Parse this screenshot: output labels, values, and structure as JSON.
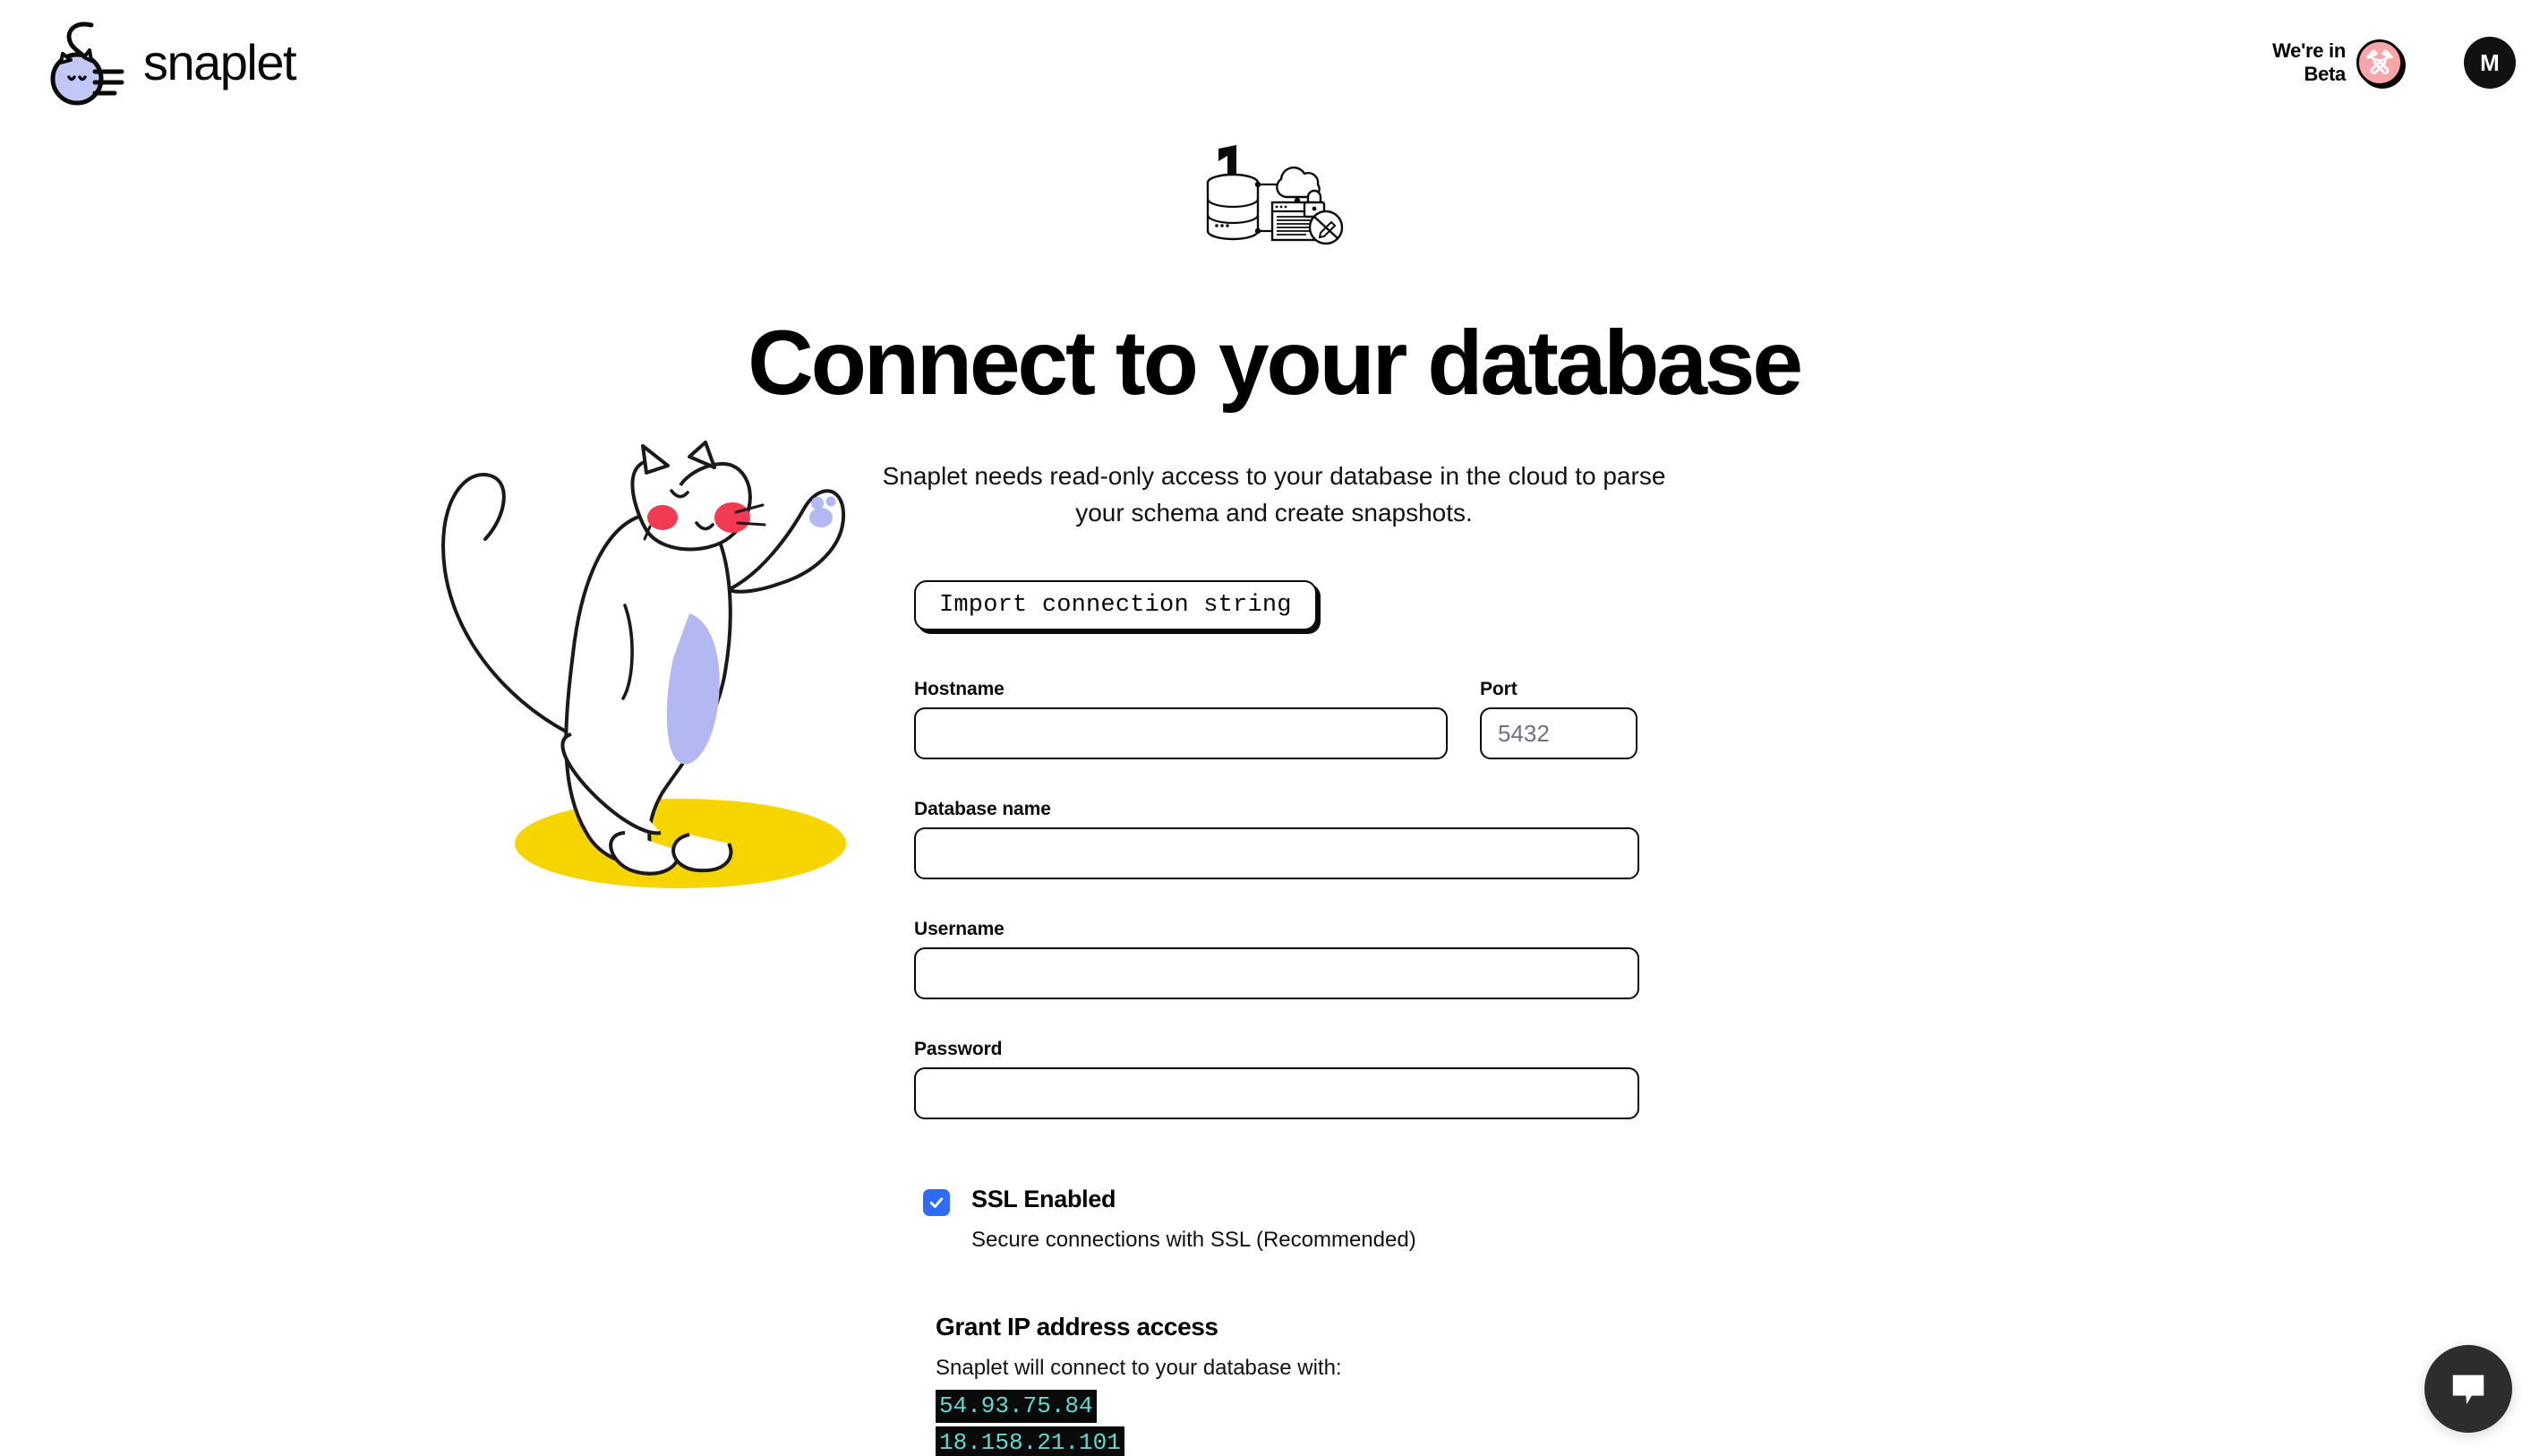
{
  "header": {
    "brand_name": "snaplet",
    "brand_logo_icon": "snaplet-cat-logo-icon",
    "beta_label": "We're in\nBeta",
    "beta_badge_icon": "crossed-wrenches-icon",
    "avatar_initial": "M"
  },
  "hero": {
    "illustration_icon": "database-cloud-readonly-illustration",
    "title": "Connect to your database",
    "subtitle": "Snaplet needs read-only access to your database in the cloud to parse your schema and create snapshots.",
    "cat_illustration_icon": "standing-cat-illustration"
  },
  "form": {
    "import_button_label": "Import connection string",
    "hostname": {
      "label": "Hostname",
      "value": "",
      "placeholder": ""
    },
    "port": {
      "label": "Port",
      "value": "",
      "placeholder": "5432"
    },
    "database_name": {
      "label": "Database name",
      "value": "",
      "placeholder": ""
    },
    "username": {
      "label": "Username",
      "value": "",
      "placeholder": ""
    },
    "password": {
      "label": "Password",
      "value": "",
      "placeholder": ""
    }
  },
  "ssl": {
    "checked": true,
    "check_icon": "checkmark-icon",
    "title": "SSL Enabled",
    "description": "Secure connections with SSL (Recommended)"
  },
  "grant_ip": {
    "title": "Grant IP address access",
    "description": "Snaplet will connect to your database with:",
    "addresses": [
      "54.93.75.84",
      "18.158.21.101"
    ]
  },
  "chat": {
    "icon": "chat-bubble-icon"
  },
  "colors": {
    "accent_blue": "#2d6cf6",
    "beta_pink": "#fba5a8",
    "ip_teal": "#5fd9d2",
    "ip_bg": "#0a0a0a",
    "cat_purple": "#b3b8f2",
    "cat_yellow": "#f5d400",
    "cat_red": "#f23b52",
    "chat_dark": "#2d2d2d",
    "page_bg": "#ffffff"
  }
}
